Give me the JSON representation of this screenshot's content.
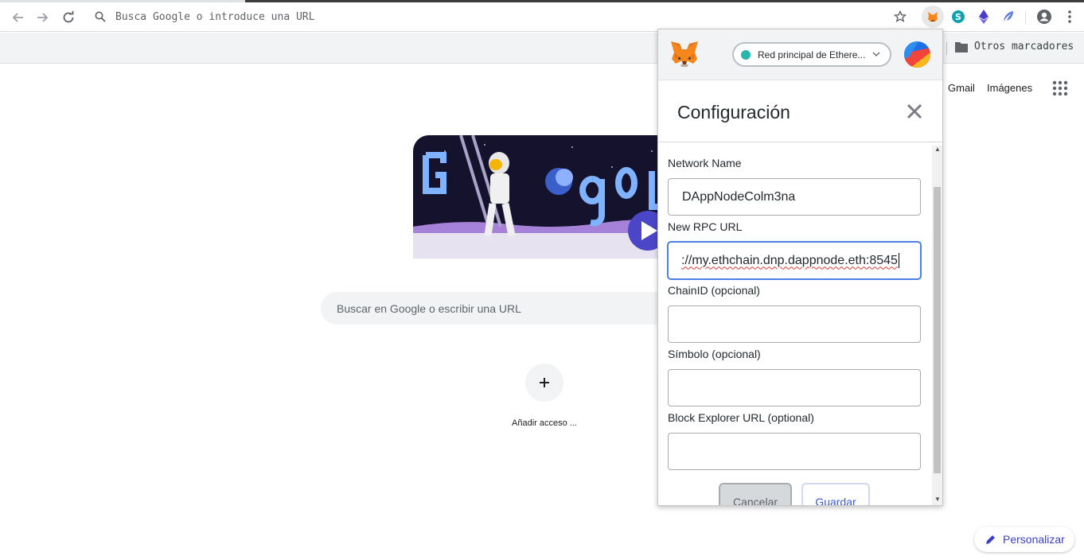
{
  "browser": {
    "omnibox_text": "Busca Google o introduce una URL",
    "bookmark_folder": "Otros marcadores"
  },
  "google": {
    "links": [
      "Gmail",
      "Imágenes"
    ],
    "search_placeholder": "Buscar en Google o escribir una URL",
    "add_shortcut_label": "Añadir acceso ...",
    "personalize_label": "Personalizar"
  },
  "metamask": {
    "network_label": "Red principal de Ethere...",
    "title": "Configuración",
    "fields": {
      "network_name_label": "Network Name",
      "network_name_value": "DAppNodeColm3na",
      "rpc_url_label": "New RPC URL",
      "rpc_url_value": "://my.ethchain.dnp.dappnode.eth:8545",
      "chain_id_label": "ChainID (opcional)",
      "chain_id_value": "",
      "symbol_label": "Símbolo (opcional)",
      "symbol_value": "",
      "explorer_label": "Block Explorer URL (optional)",
      "explorer_value": ""
    },
    "cancel_label": "Cancelar",
    "save_label": "Guardar"
  },
  "colors": {
    "metamask_network_dot": "#29b6af",
    "input_focus": "#4a80e8",
    "save_text": "#3b57d8",
    "personalize_text": "#3c40c6"
  }
}
